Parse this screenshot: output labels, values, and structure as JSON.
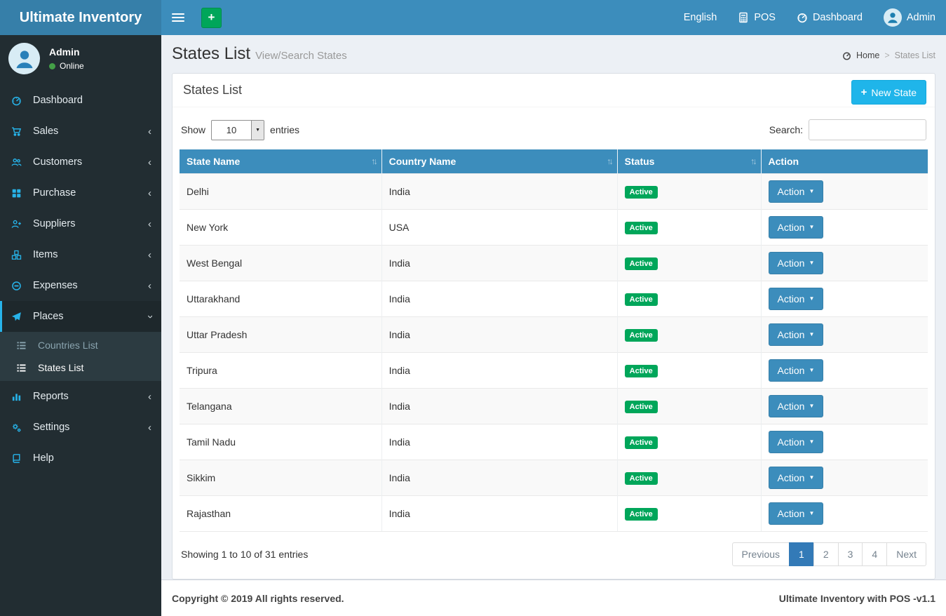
{
  "colors": {
    "navbar": "#3c8dbc",
    "logo_bg": "#367fa9",
    "sidebar_bg": "#222d32",
    "submenu_bg": "#2c3b41",
    "accent_cyan": "#27b3e9",
    "success_green": "#00a65a",
    "info_button": "#1fb5ea",
    "table_header": "#3c8dbc",
    "pagination_active": "#337ab7",
    "content_bg": "#ecf0f5",
    "online_dot": "#43a047"
  },
  "navbar": {
    "brand": "Ultimate Inventory",
    "language": "English",
    "pos_label": "POS",
    "dashboard_label": "Dashboard",
    "user": "Admin"
  },
  "sidebar": {
    "user": {
      "name": "Admin",
      "status": "Online"
    },
    "menu": [
      {
        "label": "Dashboard",
        "icon": "tachometer"
      },
      {
        "label": "Sales",
        "icon": "cart",
        "chevron": "left"
      },
      {
        "label": "Customers",
        "icon": "users",
        "chevron": "left"
      },
      {
        "label": "Purchase",
        "icon": "th-large",
        "chevron": "left"
      },
      {
        "label": "Suppliers",
        "icon": "user-plus",
        "chevron": "left"
      },
      {
        "label": "Items",
        "icon": "cubes",
        "chevron": "left"
      },
      {
        "label": "Expenses",
        "icon": "minus-circle",
        "chevron": "left"
      },
      {
        "label": "Places",
        "icon": "paper-plane",
        "chevron": "down",
        "active": true,
        "children": [
          {
            "label": "Countries List",
            "icon": "list"
          },
          {
            "label": "States List",
            "icon": "list",
            "active": true
          }
        ]
      },
      {
        "label": "Reports",
        "icon": "bar-chart",
        "chevron": "left"
      },
      {
        "label": "Settings",
        "icon": "gears",
        "chevron": "left"
      },
      {
        "label": "Help",
        "icon": "book"
      }
    ]
  },
  "page": {
    "title": "States List",
    "subtitle": "View/Search States",
    "breadcrumb": {
      "home": "Home",
      "current": "States List",
      "separator": ">"
    }
  },
  "card": {
    "title": "States List",
    "new_button": "New State"
  },
  "toolbar": {
    "show_label": "Show",
    "page_size": "10",
    "entries_label": "entries",
    "search_label": "Search:",
    "search_value": ""
  },
  "table": {
    "columns": [
      {
        "label": "State Name",
        "sortable": true
      },
      {
        "label": "Country Name",
        "sortable": true
      },
      {
        "label": "Status",
        "sortable": true
      },
      {
        "label": "Action",
        "sortable": false
      }
    ],
    "action_label": "Action",
    "rows": [
      {
        "state": "Delhi",
        "country": "India",
        "status": "Active"
      },
      {
        "state": "New York",
        "country": "USA",
        "status": "Active"
      },
      {
        "state": "West Bengal",
        "country": "India",
        "status": "Active"
      },
      {
        "state": "Uttarakhand",
        "country": "India",
        "status": "Active"
      },
      {
        "state": "Uttar Pradesh",
        "country": "India",
        "status": "Active"
      },
      {
        "state": "Tripura",
        "country": "India",
        "status": "Active"
      },
      {
        "state": "Telangana",
        "country": "India",
        "status": "Active"
      },
      {
        "state": "Tamil Nadu",
        "country": "India",
        "status": "Active"
      },
      {
        "state": "Sikkim",
        "country": "India",
        "status": "Active"
      },
      {
        "state": "Rajasthan",
        "country": "India",
        "status": "Active"
      }
    ]
  },
  "pagination": {
    "summary": "Showing 1 to 10 of 31 entries",
    "previous": "Previous",
    "pages": [
      "1",
      "2",
      "3",
      "4"
    ],
    "active_page": "1",
    "next": "Next"
  },
  "footer": {
    "left": "Copyright © 2019 All rights reserved.",
    "right": "Ultimate Inventory with POS -v1.1"
  }
}
